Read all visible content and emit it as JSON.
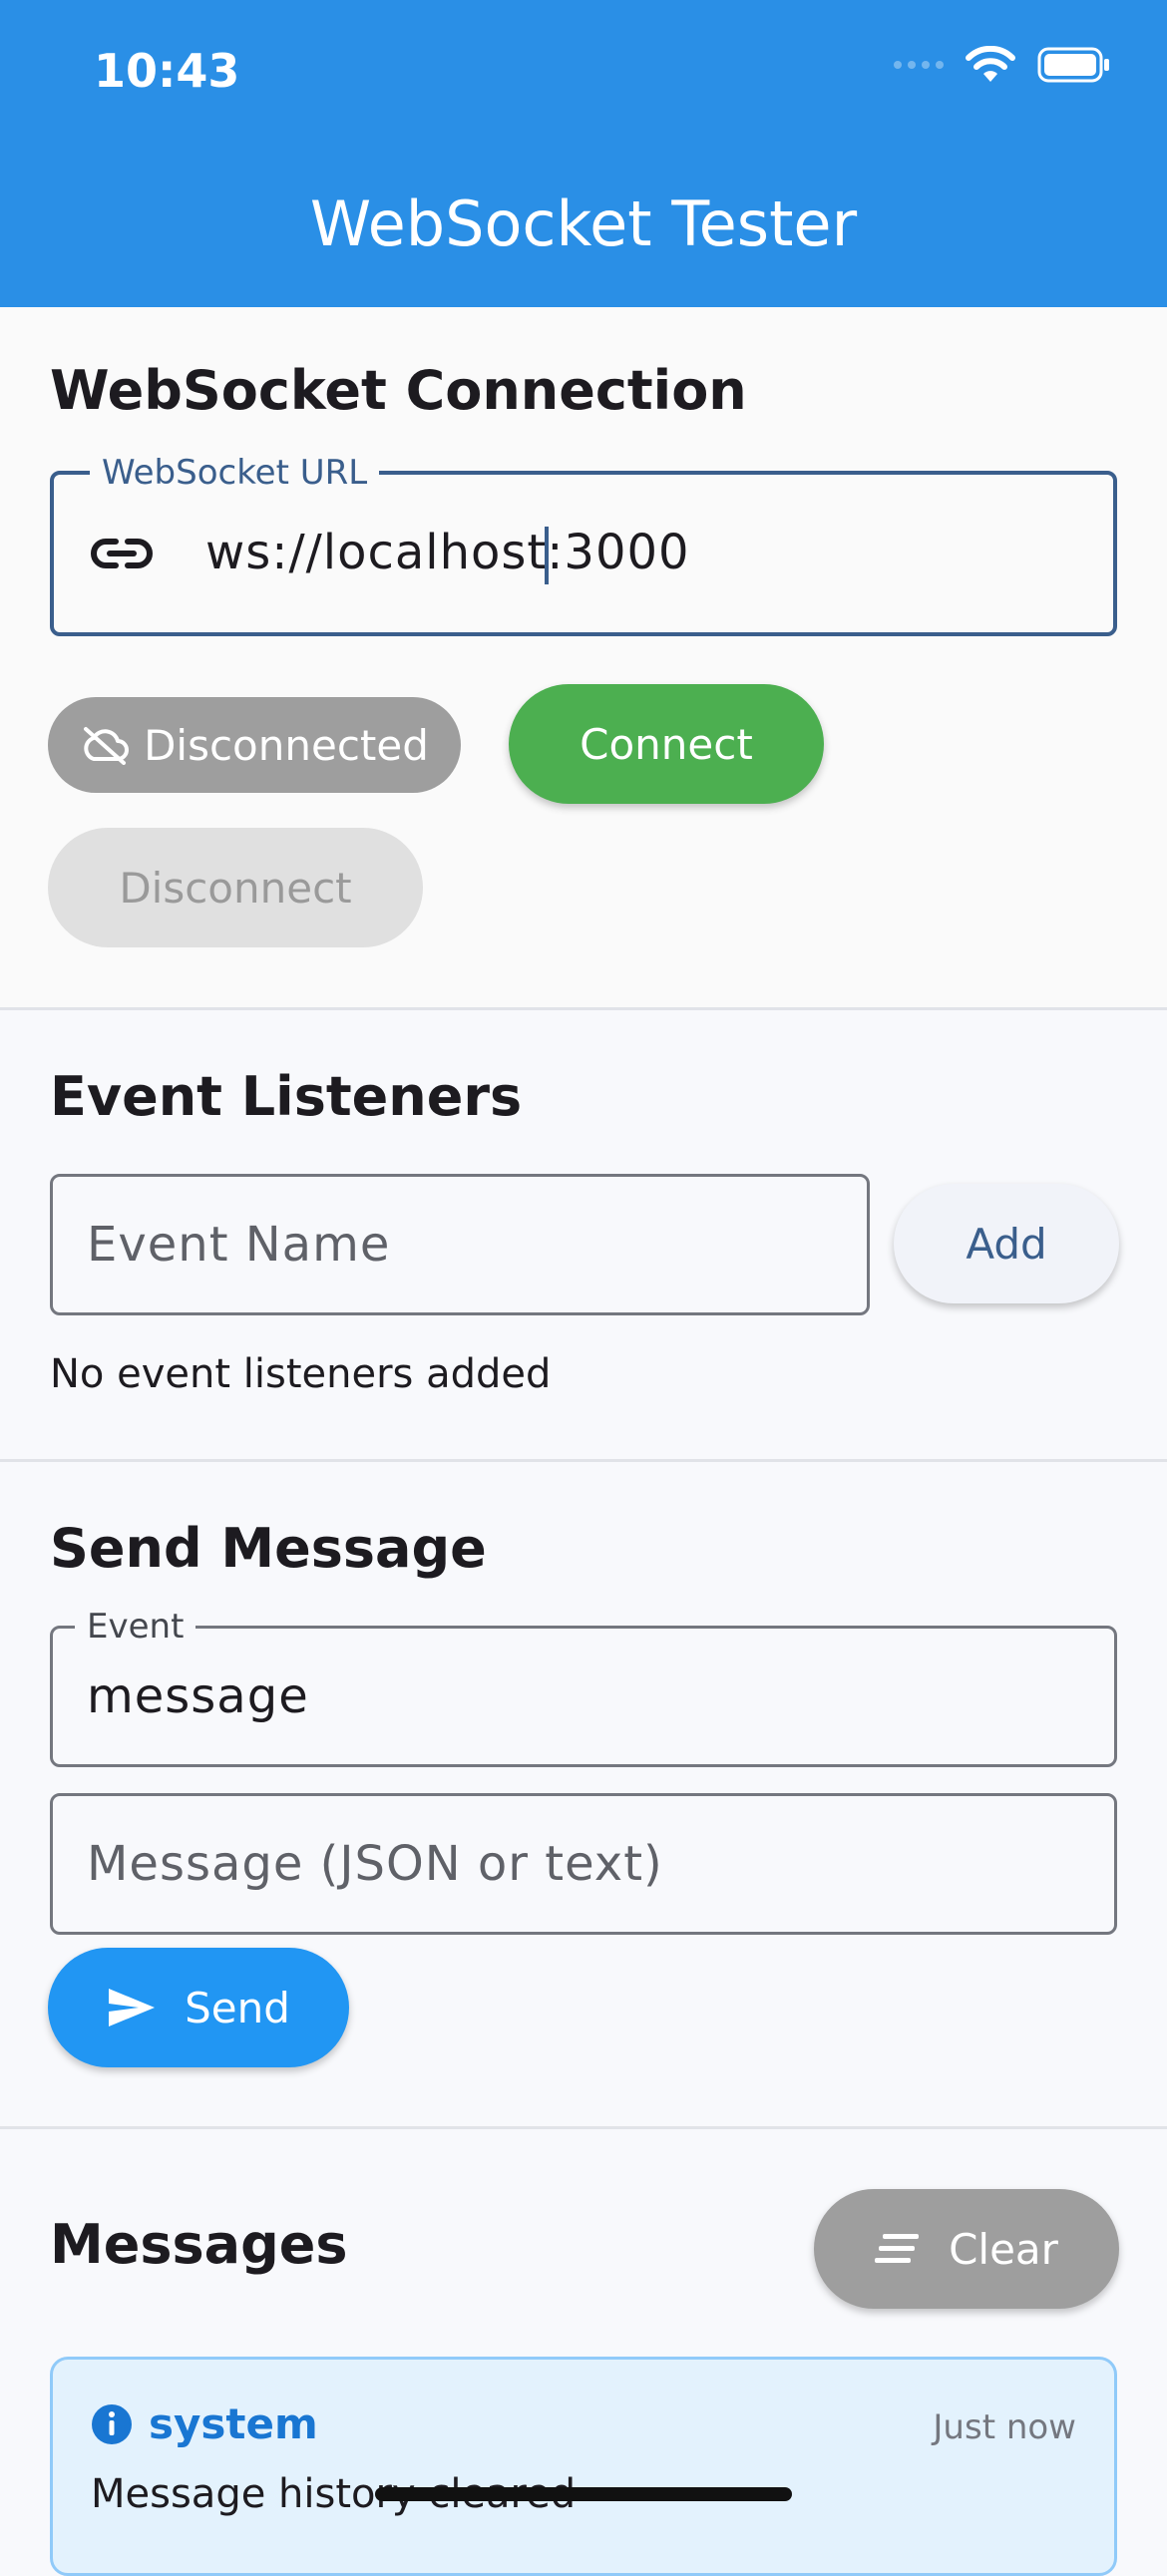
{
  "status_bar": {
    "time": "10:43"
  },
  "app_bar": {
    "title": "WebSocket Tester"
  },
  "connection": {
    "heading": "WebSocket Connection",
    "url_label": "WebSocket URL",
    "url_before_cursor": "ws://localhost",
    "url_after_cursor": ":3000",
    "status_chip": "Disconnected",
    "connect_label": "Connect",
    "disconnect_label": "Disconnect"
  },
  "listeners": {
    "heading": "Event Listeners",
    "event_name_placeholder": "Event Name",
    "add_label": "Add",
    "empty_text": "No event listeners added"
  },
  "send": {
    "heading": "Send Message",
    "event_label": "Event",
    "event_value": "message",
    "message_placeholder": "Message (JSON or text)",
    "send_label": "Send"
  },
  "messages": {
    "heading": "Messages",
    "clear_label": "Clear",
    "items": [
      {
        "type": "system",
        "time": "Just now",
        "text": "Message history cleared"
      }
    ]
  },
  "colors": {
    "app_bar": "#2a8fe6",
    "connect": "#4caf50",
    "send": "#2196f3",
    "status_disconnected": "#9e9e9e",
    "system_accent": "#1976d2"
  },
  "icons": [
    "wifi-icon",
    "battery-icon",
    "link-icon",
    "cloud-off-icon",
    "send-icon",
    "clear-all-icon",
    "info-icon"
  ]
}
